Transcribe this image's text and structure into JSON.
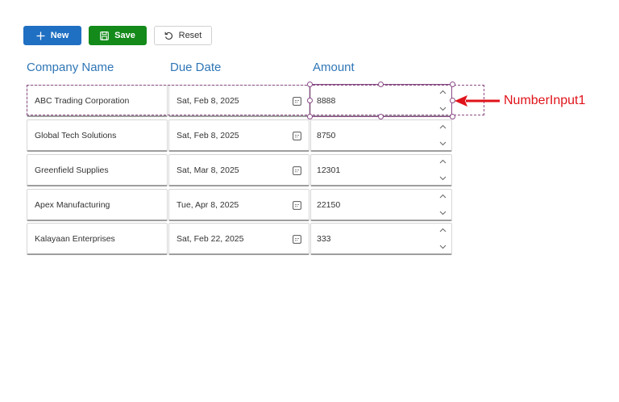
{
  "toolbar": {
    "new_label": "New",
    "save_label": "Save",
    "reset_label": "Reset"
  },
  "columns": {
    "company": "Company Name",
    "due": "Due Date",
    "amount": "Amount"
  },
  "rows": [
    {
      "company": "ABC Trading Corporation",
      "due": "Sat, Feb 8, 2025",
      "amount": "8888"
    },
    {
      "company": "Global Tech Solutions",
      "due": "Sat, Feb 8, 2025",
      "amount": "8750"
    },
    {
      "company": "Greenfield Supplies",
      "due": "Sat, Mar 8, 2025",
      "amount": "12301"
    },
    {
      "company": "Apex Manufacturing",
      "due": "Tue, Apr 8, 2025",
      "amount": "22150"
    },
    {
      "company": "Kalayaan Enterprises",
      "due": "Sat, Feb 22, 2025",
      "amount": "333"
    }
  ],
  "annotation": {
    "label": "NumberInput1",
    "color": "#e0131a"
  },
  "colors": {
    "primary": "#1f6fc2",
    "save": "#138a1a",
    "header_text": "#2f76b6",
    "selection": "#8a4a86"
  }
}
